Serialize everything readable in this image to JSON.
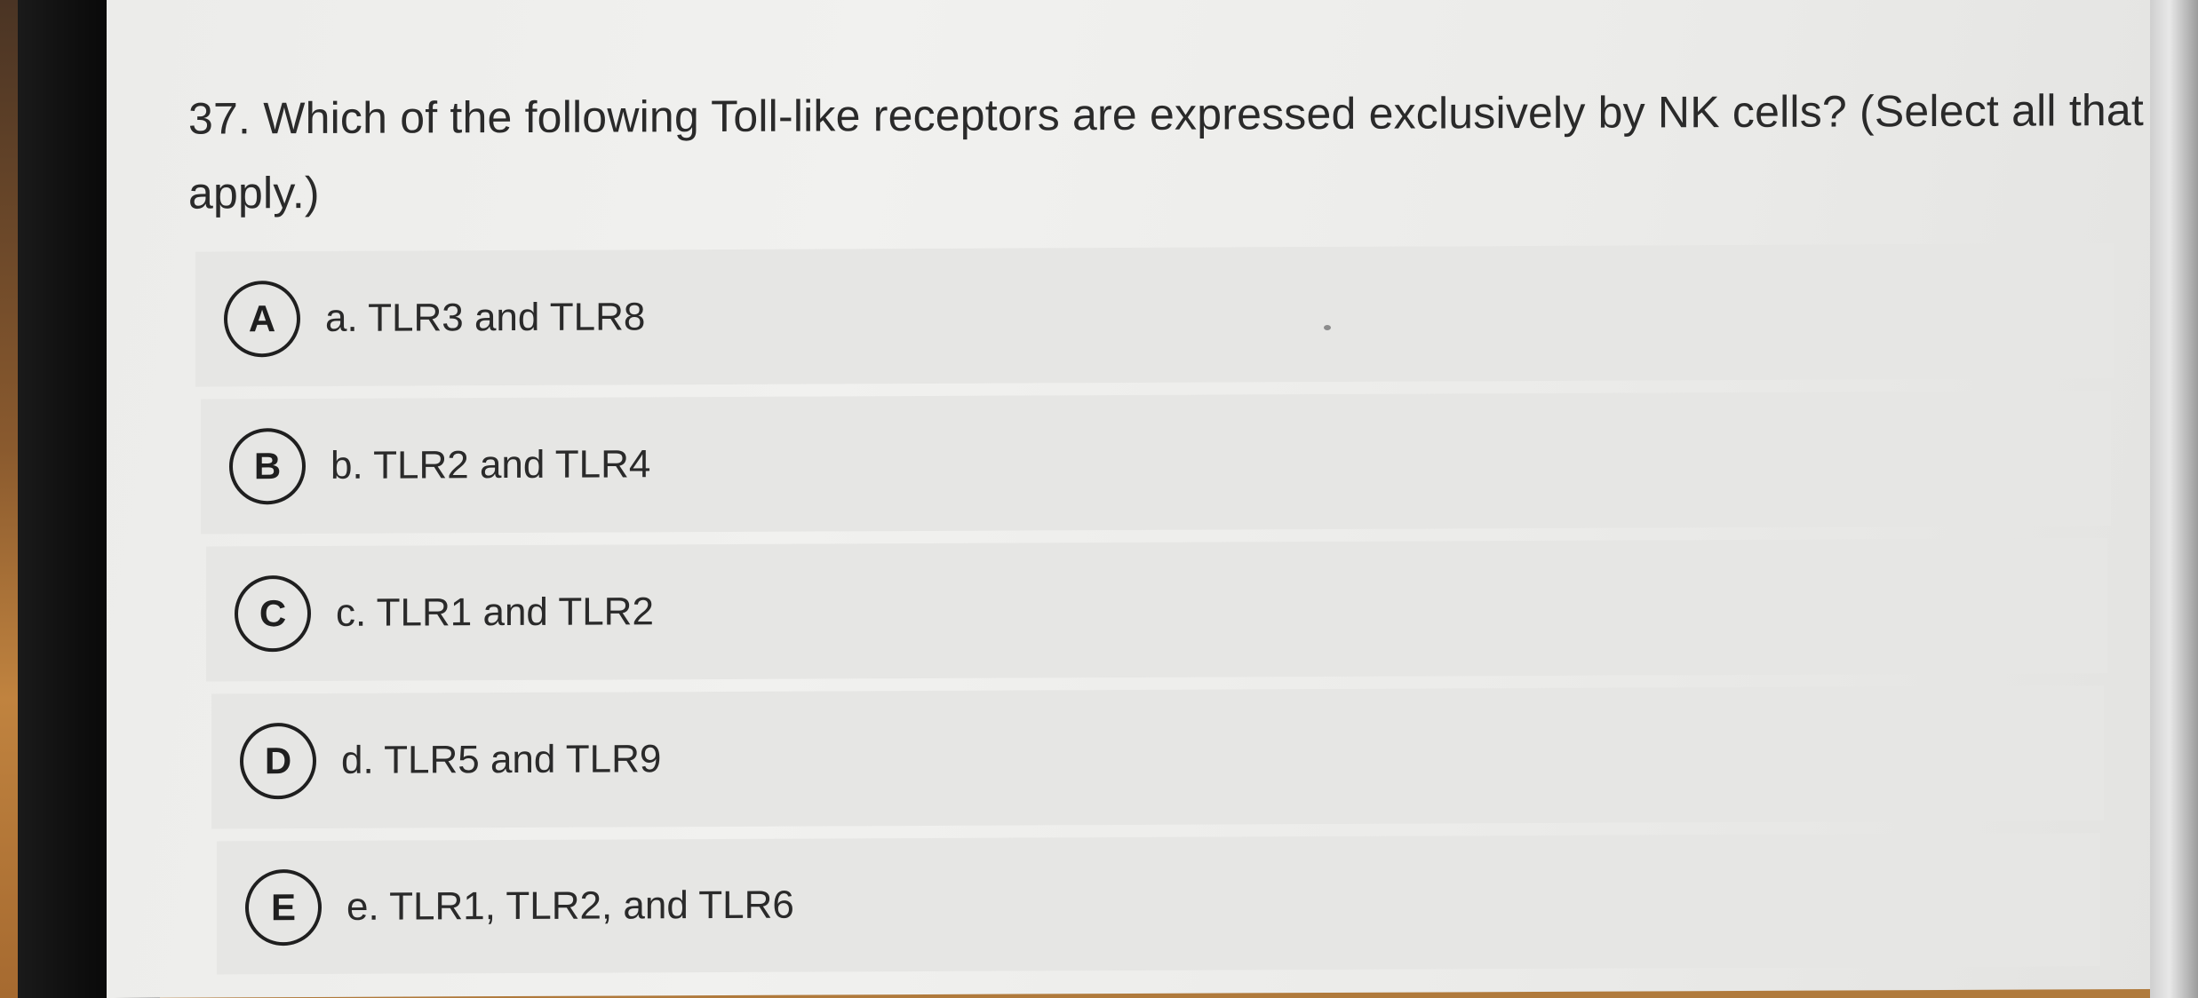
{
  "question": {
    "line1": "37. Which of the following Toll-like receptors are expressed exclusively by NK cells? (Select all that",
    "line2": "apply.)"
  },
  "options": [
    {
      "letter": "A",
      "text": "a. TLR3 and TLR8"
    },
    {
      "letter": "B",
      "text": "b. TLR2 and TLR4"
    },
    {
      "letter": "C",
      "text": "c. TLR1 and TLR2"
    },
    {
      "letter": "D",
      "text": "d. TLR5 and TLR9"
    },
    {
      "letter": "E",
      "text": "e. TLR1, TLR2, and TLR6"
    }
  ]
}
